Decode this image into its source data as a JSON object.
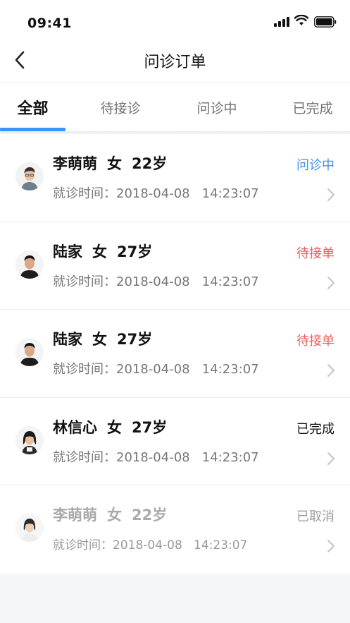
{
  "status_bar": {
    "time": "09:41"
  },
  "nav": {
    "title": "问诊订单"
  },
  "tabs": [
    {
      "label": "全部",
      "active": true
    },
    {
      "label": "待接诊",
      "active": false
    },
    {
      "label": "问诊中",
      "active": false
    },
    {
      "label": "已完成",
      "active": false
    }
  ],
  "orders": [
    {
      "name": "李萌萌",
      "gender": "女",
      "age": "22岁",
      "visit_prefix": "就诊时间：",
      "visit_date": "2018-04-08",
      "visit_time": "14:23:07",
      "status": "问诊中",
      "status_color": "#3d93f0"
    },
    {
      "name": "陆家",
      "gender": "女",
      "age": "27岁",
      "visit_prefix": "就诊时间：",
      "visit_date": "2018-04-08",
      "visit_time": "14:23:07",
      "status": "待接单",
      "status_color": "#f25c5c"
    },
    {
      "name": "陆家",
      "gender": "女",
      "age": "27岁",
      "visit_prefix": "就诊时间：",
      "visit_date": "2018-04-08",
      "visit_time": "14:23:07",
      "status": "待接单",
      "status_color": "#f25c5c"
    },
    {
      "name": "林信心",
      "gender": "女",
      "age": "27岁",
      "visit_prefix": "就诊时间：",
      "visit_date": "2018-04-08",
      "visit_time": "14:23:07",
      "status": "已完成",
      "status_color": "#111111"
    },
    {
      "name": "李萌萌",
      "gender": "女",
      "age": "22岁",
      "visit_prefix": "就诊时间：",
      "visit_date": "2018-04-08",
      "visit_time": "14:23:07",
      "status": "已取消",
      "status_color": "#9a9a9a"
    }
  ],
  "colors": {
    "accent": "#3d93f0",
    "background": "#f5f6f8"
  }
}
